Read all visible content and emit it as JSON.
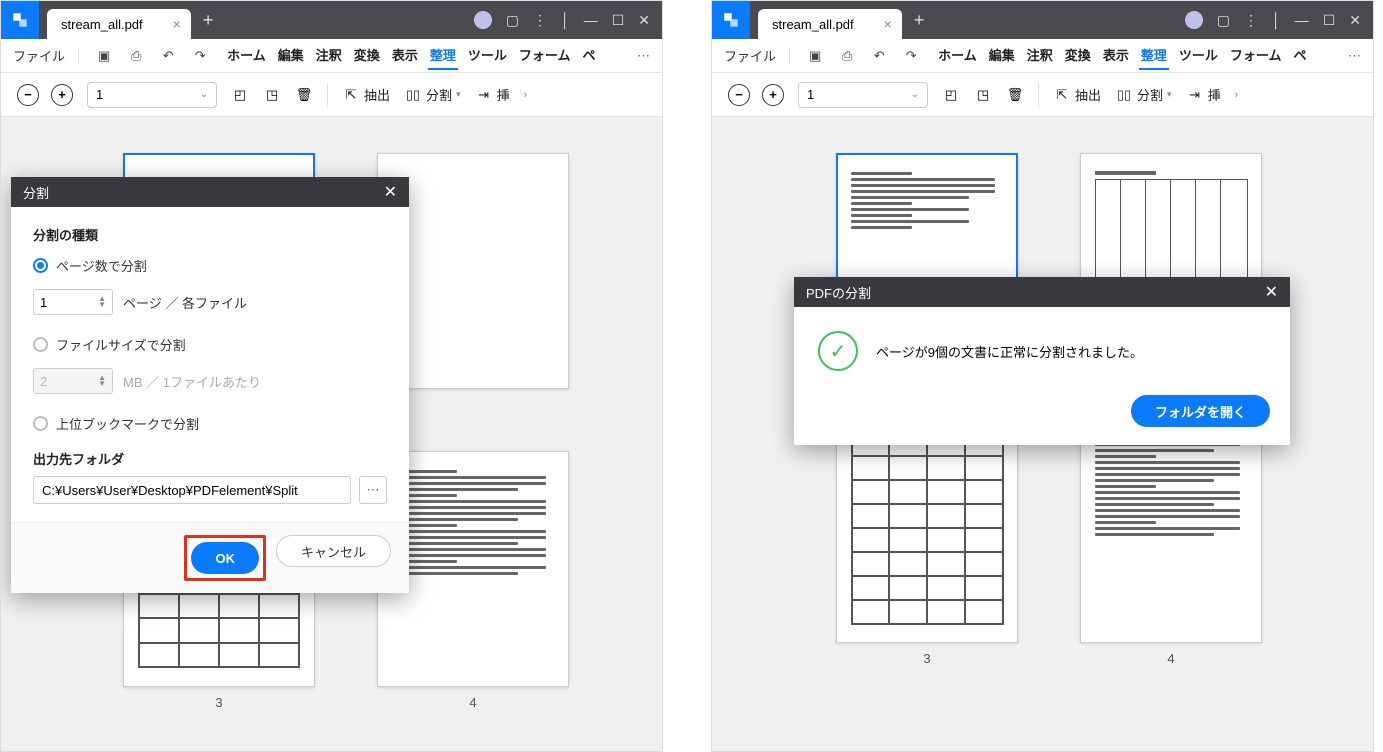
{
  "titlebar": {
    "tab_title": "stream_all.pdf"
  },
  "menubar": {
    "file": "ファイル",
    "tabs": [
      "ホーム",
      "編集",
      "注釈",
      "変換",
      "表示",
      "整理",
      "ツール",
      "フォーム"
    ],
    "active": "整理",
    "more1": "ペ",
    "more2": "ペ"
  },
  "actionbar": {
    "page_value": "1",
    "extract": "抽出",
    "split": "分割",
    "insert": "挿"
  },
  "thumbs_left": {
    "p3": "3",
    "p4": "4"
  },
  "thumbs_right": {
    "p1": "",
    "p2": "",
    "p3": "3",
    "p4": "4"
  },
  "split_dialog": {
    "title": "分割",
    "section": "分割の種類",
    "opt_pages": "ページ数で分割",
    "pages_value": "1",
    "pages_suffix": "ページ ／ 各ファイル",
    "opt_size": "ファイルサイズで分割",
    "size_value": "2",
    "size_suffix": "MB ／ 1ファイルあたり",
    "opt_bookmark": "上位ブックマークで分割",
    "folder_label": "出力先フォルダ",
    "folder_path": "C:¥Users¥User¥Desktop¥PDFelement¥Split",
    "ok": "OK",
    "cancel": "キャンセル"
  },
  "result_dialog": {
    "title": "PDFの分割",
    "message": "ページが9個の文書に正常に分割されました。",
    "open": "フォルダを開く"
  }
}
